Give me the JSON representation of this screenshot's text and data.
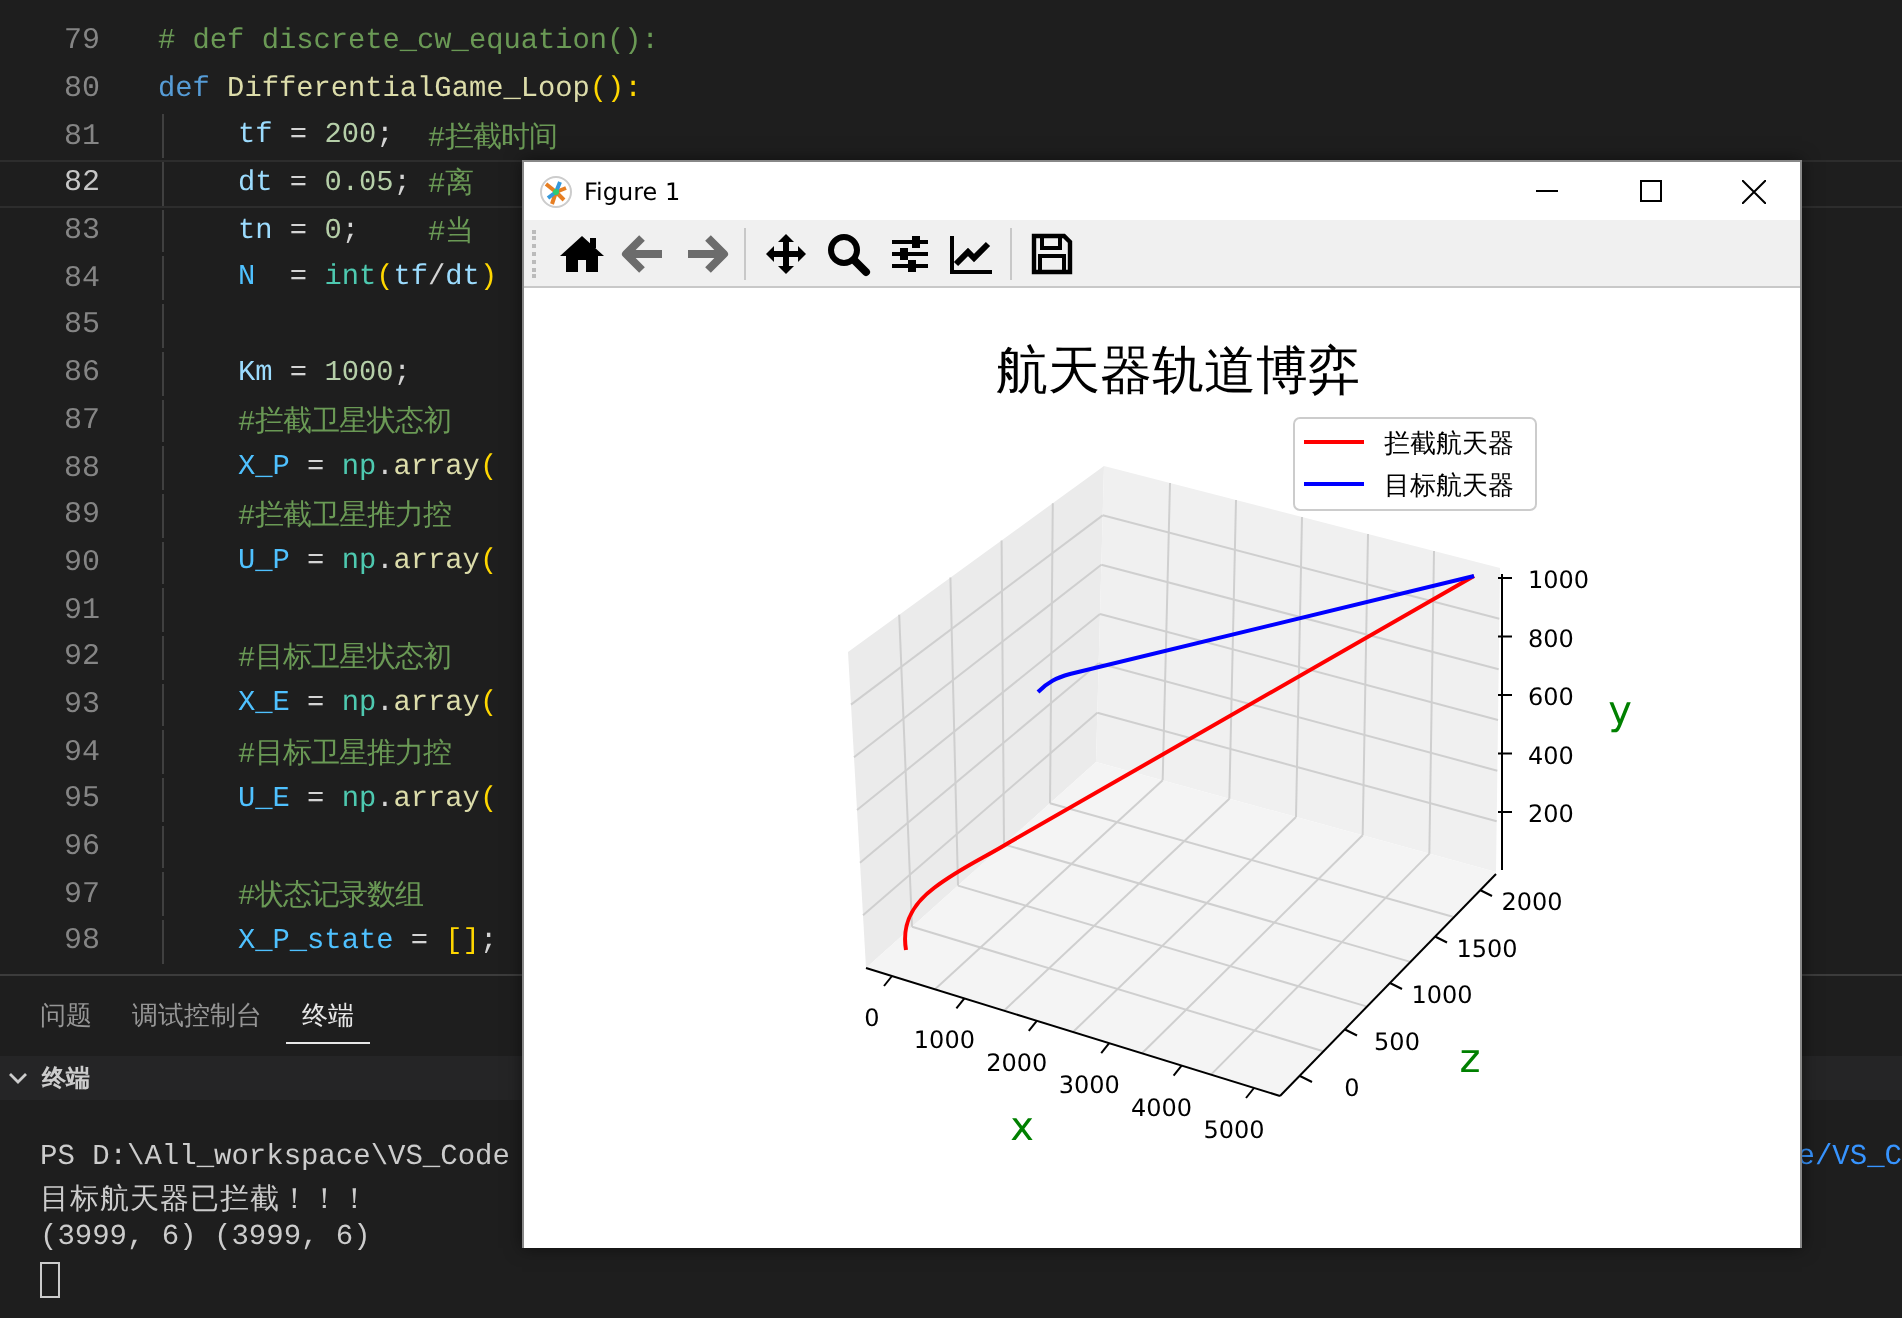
{
  "editor": {
    "lines": [
      {
        "number": "79",
        "indent": false,
        "current": false,
        "tokens": [
          {
            "kind": "comment",
            "text": "# def discrete_cw_equation():"
          }
        ]
      },
      {
        "number": "80",
        "indent": false,
        "current": false,
        "tokens": [
          {
            "kind": "keyword",
            "text": "def"
          },
          {
            "kind": "func",
            "text": " DifferentialGame_Loop"
          },
          {
            "kind": "bracket",
            "text": "():"
          }
        ]
      },
      {
        "number": "81",
        "indent": true,
        "current": false,
        "tokens": [
          {
            "kind": "var",
            "text": "tf"
          },
          {
            "kind": "plain",
            "text": " = "
          },
          {
            "kind": "number",
            "text": "200"
          },
          {
            "kind": "plain",
            "text": ";  "
          },
          {
            "kind": "comment",
            "text": "#拦截时间"
          }
        ]
      },
      {
        "number": "82",
        "indent": true,
        "current": true,
        "tokens": [
          {
            "kind": "var",
            "text": "dt"
          },
          {
            "kind": "plain",
            "text": " = "
          },
          {
            "kind": "number",
            "text": "0.05"
          },
          {
            "kind": "plain",
            "text": "; "
          },
          {
            "kind": "comment",
            "text": "#离"
          }
        ]
      },
      {
        "number": "83",
        "indent": true,
        "current": false,
        "tokens": [
          {
            "kind": "var",
            "text": "tn"
          },
          {
            "kind": "plain",
            "text": " = "
          },
          {
            "kind": "number",
            "text": "0"
          },
          {
            "kind": "plain",
            "text": ";    "
          },
          {
            "kind": "comment",
            "text": "#当"
          }
        ]
      },
      {
        "number": "84",
        "indent": true,
        "current": false,
        "tokens": [
          {
            "kind": "const",
            "text": "N"
          },
          {
            "kind": "plain",
            "text": "  = "
          },
          {
            "kind": "builtin",
            "text": "int"
          },
          {
            "kind": "bracket",
            "text": "("
          },
          {
            "kind": "var",
            "text": "tf"
          },
          {
            "kind": "plain",
            "text": "/"
          },
          {
            "kind": "var",
            "text": "dt"
          },
          {
            "kind": "bracket",
            "text": ")"
          }
        ]
      },
      {
        "number": "85",
        "indent": true,
        "current": false
      },
      {
        "number": "86",
        "indent": true,
        "current": false,
        "tokens": [
          {
            "kind": "var",
            "text": "Km"
          },
          {
            "kind": "plain",
            "text": " = "
          },
          {
            "kind": "number",
            "text": "1000"
          },
          {
            "kind": "plain",
            "text": ";"
          }
        ]
      },
      {
        "number": "87",
        "indent": true,
        "current": false,
        "tokens": [
          {
            "kind": "comment",
            "text": "#拦截卫星状态初"
          }
        ]
      },
      {
        "number": "88",
        "indent": true,
        "current": false,
        "tokens": [
          {
            "kind": "const",
            "text": "X_P"
          },
          {
            "kind": "plain",
            "text": " = "
          },
          {
            "kind": "builtin",
            "text": "np"
          },
          {
            "kind": "plain",
            "text": "."
          },
          {
            "kind": "func",
            "text": "array"
          },
          {
            "kind": "bracket",
            "text": "("
          }
        ]
      },
      {
        "number": "89",
        "indent": true,
        "current": false,
        "tokens": [
          {
            "kind": "comment",
            "text": "#拦截卫星推力控"
          }
        ]
      },
      {
        "number": "90",
        "indent": true,
        "current": false,
        "tokens": [
          {
            "kind": "const",
            "text": "U_P"
          },
          {
            "kind": "plain",
            "text": " = "
          },
          {
            "kind": "builtin",
            "text": "np"
          },
          {
            "kind": "plain",
            "text": "."
          },
          {
            "kind": "func",
            "text": "array"
          },
          {
            "kind": "bracket",
            "text": "("
          }
        ]
      },
      {
        "number": "91",
        "indent": true,
        "current": false
      },
      {
        "number": "92",
        "indent": true,
        "current": false,
        "tokens": [
          {
            "kind": "comment",
            "text": "#目标卫星状态初"
          }
        ]
      },
      {
        "number": "93",
        "indent": true,
        "current": false,
        "tokens": [
          {
            "kind": "const",
            "text": "X_E"
          },
          {
            "kind": "plain",
            "text": " = "
          },
          {
            "kind": "builtin",
            "text": "np"
          },
          {
            "kind": "plain",
            "text": "."
          },
          {
            "kind": "func",
            "text": "array"
          },
          {
            "kind": "bracket",
            "text": "("
          }
        ]
      },
      {
        "number": "94",
        "indent": true,
        "current": false,
        "tokens": [
          {
            "kind": "comment",
            "text": "#目标卫星推力控"
          }
        ]
      },
      {
        "number": "95",
        "indent": true,
        "current": false,
        "tokens": [
          {
            "kind": "const",
            "text": "U_E"
          },
          {
            "kind": "plain",
            "text": " = "
          },
          {
            "kind": "builtin",
            "text": "np"
          },
          {
            "kind": "plain",
            "text": "."
          },
          {
            "kind": "func",
            "text": "array"
          },
          {
            "kind": "bracket",
            "text": "("
          }
        ]
      },
      {
        "number": "96",
        "indent": true,
        "current": false
      },
      {
        "number": "97",
        "indent": true,
        "current": false,
        "tokens": [
          {
            "kind": "comment",
            "text": "#状态记录数组"
          }
        ]
      },
      {
        "number": "98",
        "indent": true,
        "current": false,
        "tokens": [
          {
            "kind": "const",
            "text": "X_P_state"
          },
          {
            "kind": "plain",
            "text": " = "
          },
          {
            "kind": "bracket",
            "text": "[]"
          },
          {
            "kind": "plain",
            "text": ";"
          }
        ]
      }
    ]
  },
  "panel": {
    "tabs": [
      {
        "label": "问题",
        "selected": false
      },
      {
        "label": "调试控制台",
        "selected": false
      },
      {
        "label": "终端",
        "selected": true
      }
    ],
    "section": {
      "title": "终端",
      "expanded": true
    },
    "terminal": {
      "lines": [
        "PS D:\\All_workspace\\VS_Code",
        "目标航天器已拦截！！！",
        "(3999, 6) (3999, 6)"
      ],
      "right_text": "e/VS_C"
    }
  },
  "figure": {
    "title": "Figure 1",
    "toolbar": [
      {
        "disabled": false
      },
      {
        "disabled": true
      },
      {
        "disabled": true
      },
      {
        "disabled": false
      },
      {
        "disabled": false
      },
      {
        "disabled": false
      },
      {
        "disabled": false
      },
      {
        "disabled": false
      }
    ],
    "plot": {
      "title": "航天器轨道博弈",
      "legend": [
        {
          "label": "拦截航天器",
          "color": "#ff0000"
        },
        {
          "label": "目标航天器",
          "color": "#0000ff"
        }
      ],
      "x_ticks": [
        "0",
        "1000",
        "2000",
        "3000",
        "4000",
        "5000"
      ],
      "z_ticks": [
        "0",
        "500",
        "1000",
        "1500",
        "2000"
      ],
      "y_ticks": [
        "1000",
        "800",
        "600",
        "400",
        "200"
      ],
      "x_label": "x",
      "y_label": "y",
      "z_label": "z"
    }
  }
}
